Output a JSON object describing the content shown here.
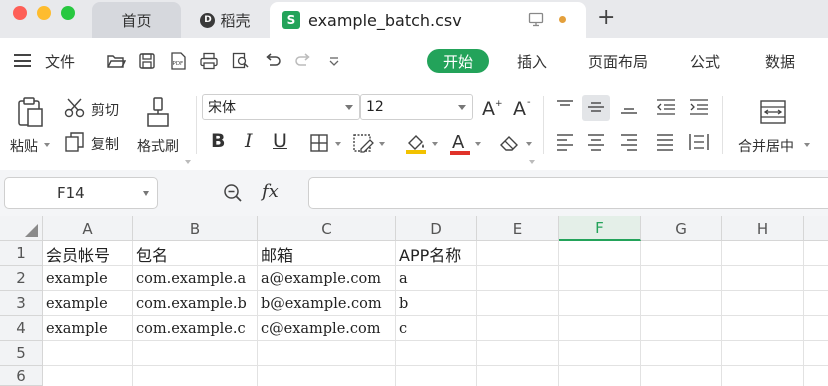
{
  "window": {
    "tabs": [
      {
        "label": "首页"
      },
      {
        "label": "稻壳"
      },
      {
        "label": "example_batch.csv"
      }
    ],
    "sheet_icon": "S",
    "docer_icon": "D"
  },
  "menu": {
    "file": "文件",
    "items": [
      "开始",
      "插入",
      "页面布局",
      "公式",
      "数据"
    ]
  },
  "ribbon": {
    "paste": "粘贴",
    "cut": "剪切",
    "copy": "复制",
    "format_painter": "格式刷",
    "font_name": "宋体",
    "font_size": "12",
    "bold": "B",
    "italic": "I",
    "underline": "U",
    "merge_center": "合并居中",
    "accent": "#23a35a"
  },
  "formula_bar": {
    "cell_ref": "F14",
    "fx": "fx",
    "value": ""
  },
  "sheet": {
    "columns": [
      "A",
      "B",
      "C",
      "D",
      "E",
      "F",
      "G",
      "H"
    ],
    "selected_column": "F",
    "rows": [
      "1",
      "2",
      "3",
      "4",
      "5",
      "6"
    ],
    "cells": [
      [
        "会员帐号",
        "包名",
        "邮箱",
        "APP名称"
      ],
      [
        "example",
        "com.example.a",
        "a@example.com",
        "a"
      ],
      [
        "example",
        "com.example.b",
        "b@example.com",
        "b"
      ],
      [
        "example",
        "com.example.c",
        "c@example.com",
        "c"
      ]
    ]
  }
}
